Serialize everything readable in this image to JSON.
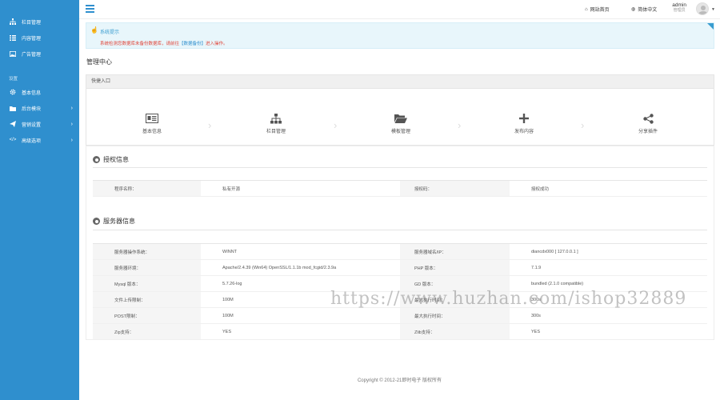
{
  "sidebar": {
    "items": [
      {
        "label": "栏目管理",
        "icon": "sitemap-icon"
      },
      {
        "label": "内容管理",
        "icon": "list-icon"
      },
      {
        "label": "广告管理",
        "icon": "image-icon"
      }
    ],
    "group_title": "设置",
    "settings": [
      {
        "label": "基本信息",
        "icon": "gear-icon",
        "has_arrow": false
      },
      {
        "label": "后台模块",
        "icon": "folder-icon",
        "has_arrow": true
      },
      {
        "label": "营销设置",
        "icon": "send-icon",
        "has_arrow": true
      },
      {
        "label": "高级选项",
        "icon": "code-icon",
        "has_arrow": true
      }
    ],
    "colors": {
      "background": "#2f8fce"
    }
  },
  "header": {
    "home_link": "网站首页",
    "lang_link": "简体中文",
    "user_name": "admin",
    "user_role": "管理员"
  },
  "alert": {
    "title": "系统提示",
    "message_pre": "系统检测您数据库未备份数据库，请前往",
    "message_link": "【数据备份】",
    "message_post": "进入操作。"
  },
  "page_title": "管理中心",
  "quick_entry": {
    "title": "快捷入口",
    "items": [
      {
        "label": "基本信息",
        "icon": "id-card-icon"
      },
      {
        "label": "栏目管理",
        "icon": "sitemap-icon"
      },
      {
        "label": "模板管理",
        "icon": "folder-open-icon"
      },
      {
        "label": "发布内容",
        "icon": "plus-icon"
      },
      {
        "label": "分享插件",
        "icon": "share-icon"
      }
    ]
  },
  "site_info": {
    "title": "授权信息",
    "rows": [
      {
        "k1": "程序名称：",
        "v1": "私有开源",
        "k2": "授权码：",
        "v2": "授权成功"
      }
    ]
  },
  "server_info": {
    "title": "服务器信息",
    "rows": [
      {
        "k1": "服务器操作系统：",
        "v1": "WINNT",
        "k2": "服务器域名/IP：",
        "v2": "diancdx000 [ 127.0.0.1 ]"
      },
      {
        "k1": "服务器环境：",
        "v1": "Apache/2.4.39 (Win64) OpenSSL/1.1.1b mod_fcgid/2.3.9a",
        "k2": "PHP 版本：",
        "v2": "7.1.9"
      },
      {
        "k1": "Mysql 版本：",
        "v1": "5.7.26-log",
        "k2": "GD 版本：",
        "v2": "bundled (2.1.0 compatible)"
      },
      {
        "k1": "文件上传限制：",
        "v1": "100M",
        "k2": "最大执行时间：",
        "v2": "300s"
      },
      {
        "k1": "POST限制：",
        "v1": "100M",
        "k2": "最大执行时间：",
        "v2": "300s"
      },
      {
        "k1": "Zip支持：",
        "v1": "YES",
        "k2": "Zlib支持：",
        "v2": "YES"
      }
    ]
  },
  "watermark": "https://www.huzhan.com/ishop32889",
  "footer": "Copyright © 2012-21即时电子 版权所有"
}
